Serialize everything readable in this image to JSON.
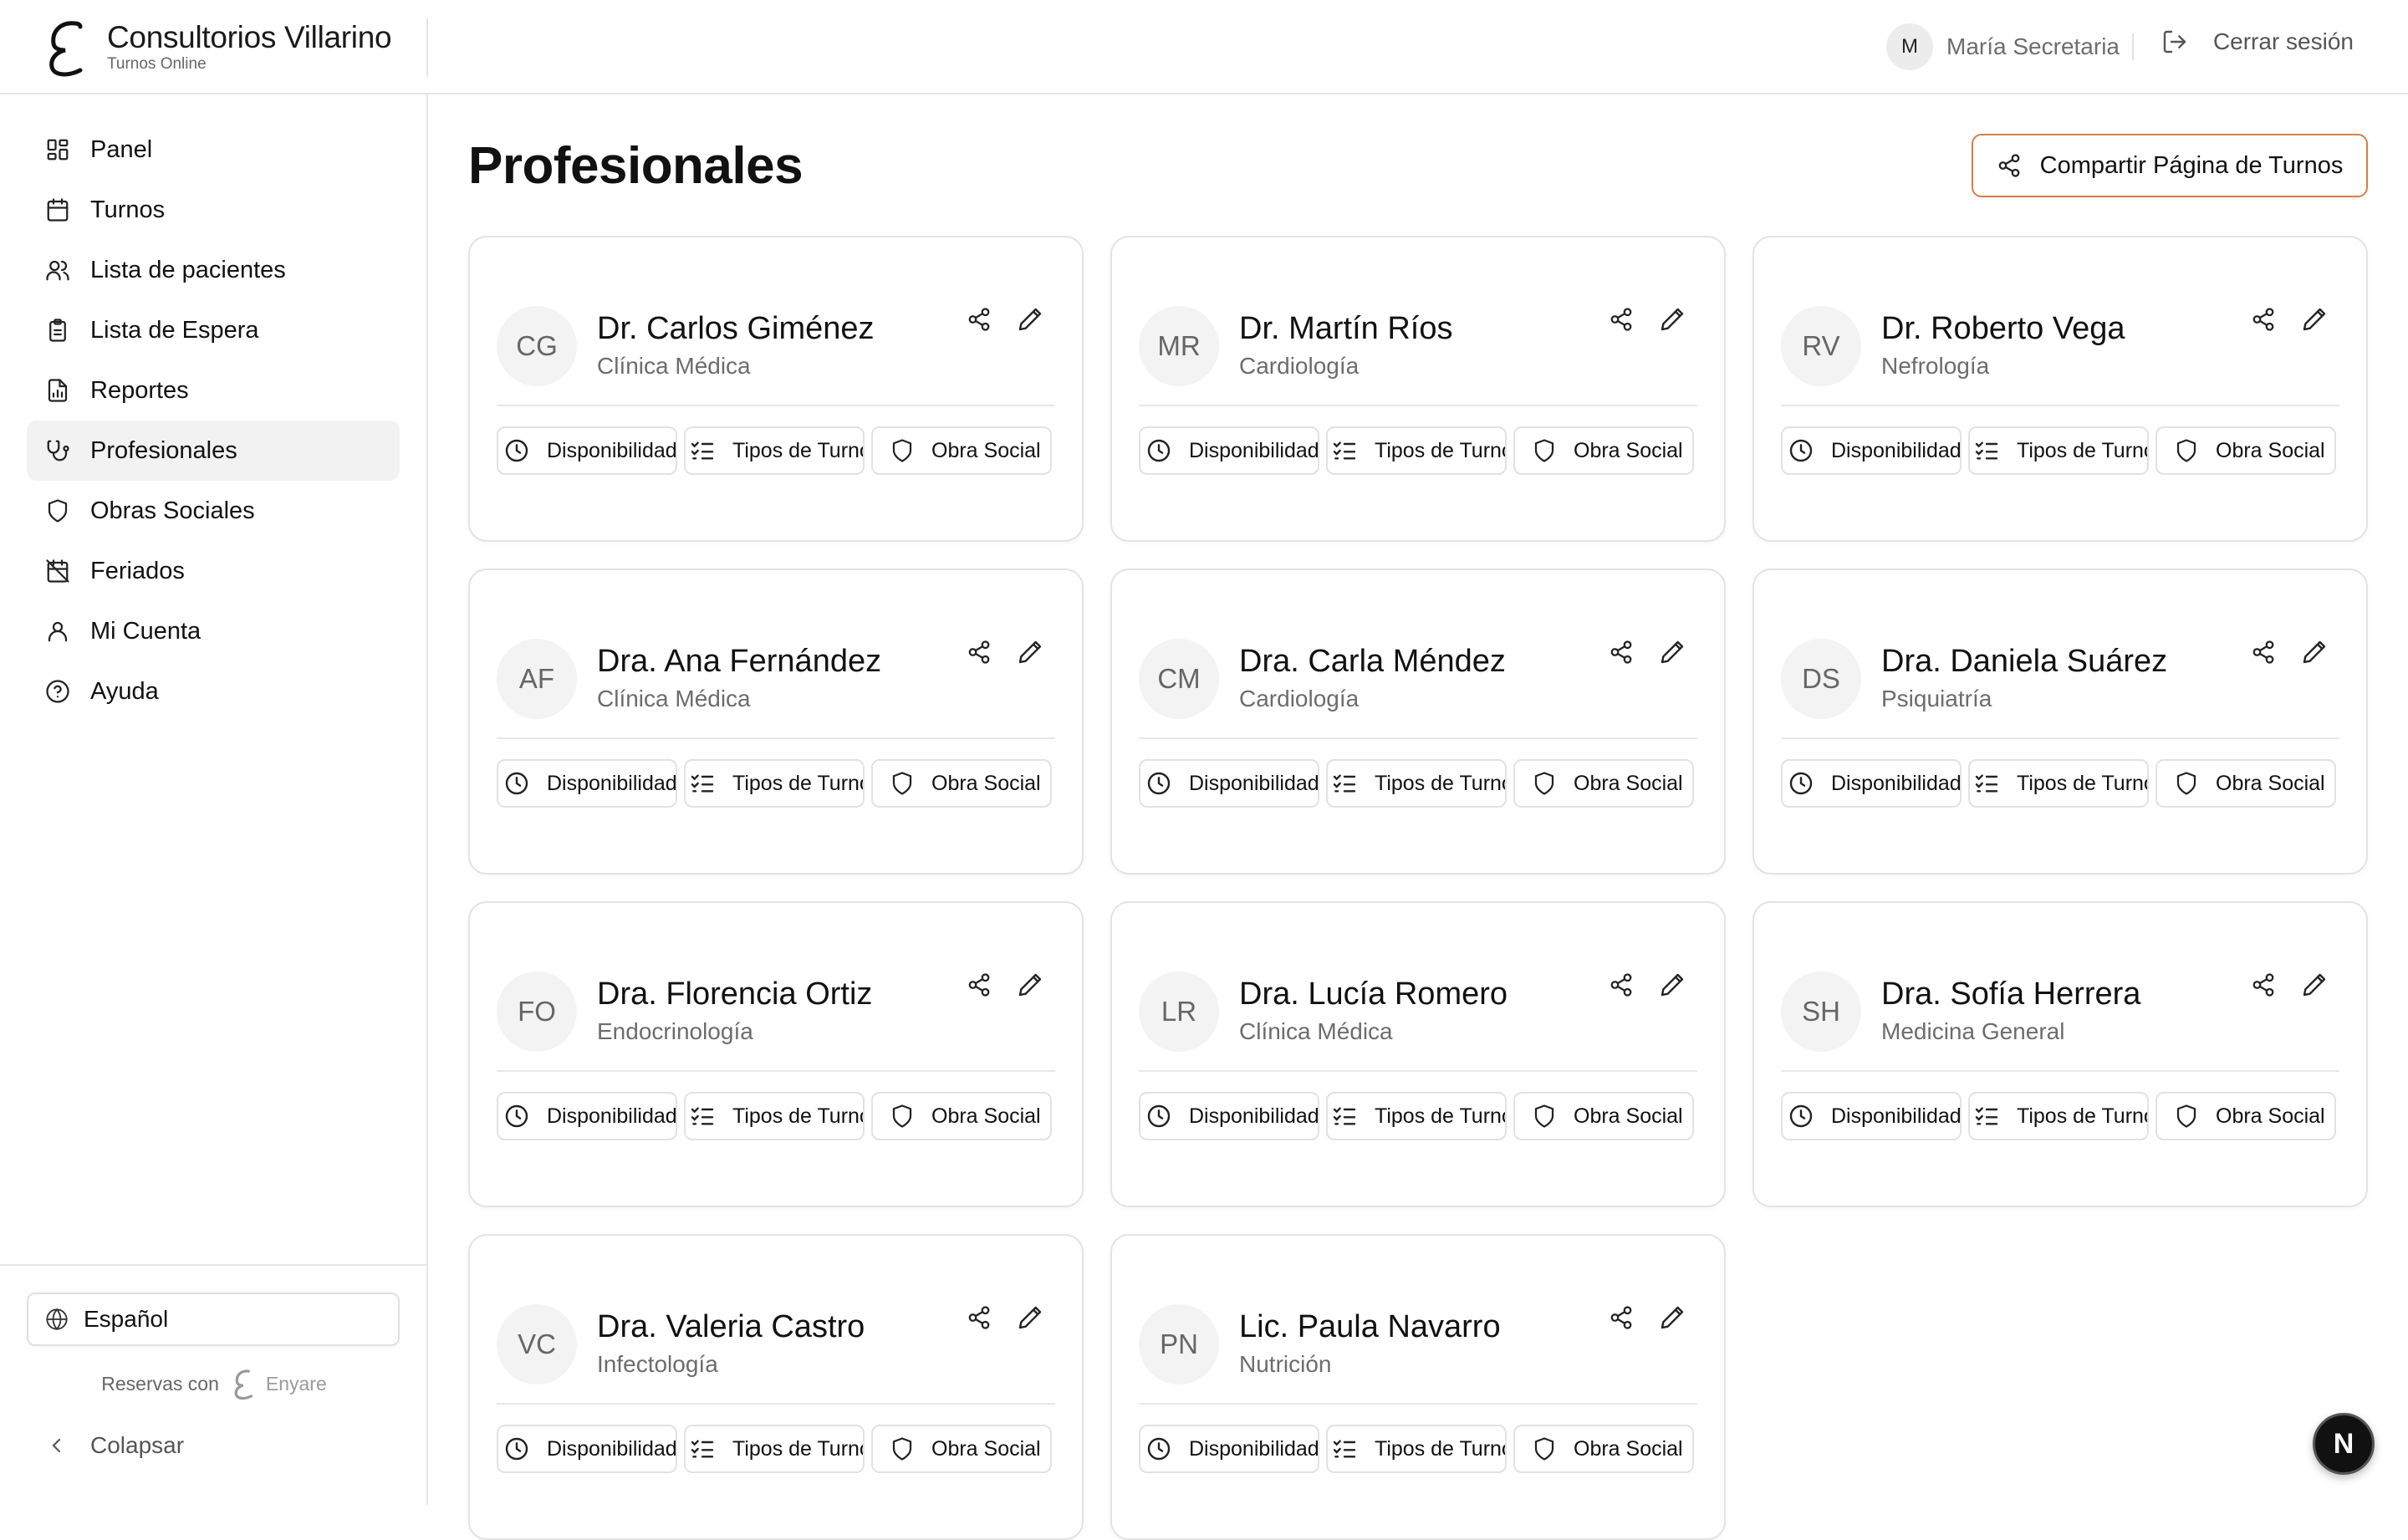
{
  "app": {
    "title": "Consultorios Villarino",
    "subtitle": "Turnos Online"
  },
  "header": {
    "user_initial": "M",
    "user_name": "María Secretaria",
    "logout_label": "Cerrar sesión"
  },
  "sidebar": {
    "items": [
      {
        "label": "Panel",
        "icon": "dashboard-icon"
      },
      {
        "label": "Turnos",
        "icon": "calendar-icon"
      },
      {
        "label": "Lista de pacientes",
        "icon": "users-icon"
      },
      {
        "label": "Lista de Espera",
        "icon": "clipboard-icon"
      },
      {
        "label": "Reportes",
        "icon": "report-icon"
      },
      {
        "label": "Profesionales",
        "icon": "stethoscope-icon",
        "active": true
      },
      {
        "label": "Obras Sociales",
        "icon": "shield-icon"
      },
      {
        "label": "Feriados",
        "icon": "calendar-off-icon"
      },
      {
        "label": "Mi Cuenta",
        "icon": "user-icon"
      },
      {
        "label": "Ayuda",
        "icon": "help-icon"
      }
    ],
    "language": "Español",
    "powered_prefix": "Reservas con",
    "powered_brand": "Enyare",
    "collapse_label": "Colapsar"
  },
  "main": {
    "title": "Profesionales",
    "share_button": "Compartir Página de Turnos",
    "card_actions": {
      "availability": "Disponibilidad",
      "types": "Tipos de Turno",
      "insurance": "Obra Social"
    },
    "professionals": [
      {
        "initials": "CG",
        "name": "Dr. Carlos Giménez",
        "specialty": "Clínica Médica"
      },
      {
        "initials": "MR",
        "name": "Dr. Martín Ríos",
        "specialty": "Cardiología"
      },
      {
        "initials": "RV",
        "name": "Dr. Roberto Vega",
        "specialty": "Nefrología"
      },
      {
        "initials": "AF",
        "name": "Dra. Ana Fernández",
        "specialty": "Clínica Médica"
      },
      {
        "initials": "CM",
        "name": "Dra. Carla Méndez",
        "specialty": "Cardiología"
      },
      {
        "initials": "DS",
        "name": "Dra. Daniela Suárez",
        "specialty": "Psiquiatría"
      },
      {
        "initials": "FO",
        "name": "Dra. Florencia Ortiz",
        "specialty": "Endocrinología"
      },
      {
        "initials": "LR",
        "name": "Dra. Lucía Romero",
        "specialty": "Clínica Médica"
      },
      {
        "initials": "SH",
        "name": "Dra. Sofía Herrera",
        "specialty": "Medicina General"
      },
      {
        "initials": "VC",
        "name": "Dra. Valeria Castro",
        "specialty": "Infectología"
      },
      {
        "initials": "PN",
        "name": "Lic. Paula Navarro",
        "specialty": "Nutrición"
      }
    ]
  },
  "fab_label": "N",
  "colors": {
    "accent_border": "#d97f45",
    "active_nav_bg": "#f2f2f2"
  }
}
